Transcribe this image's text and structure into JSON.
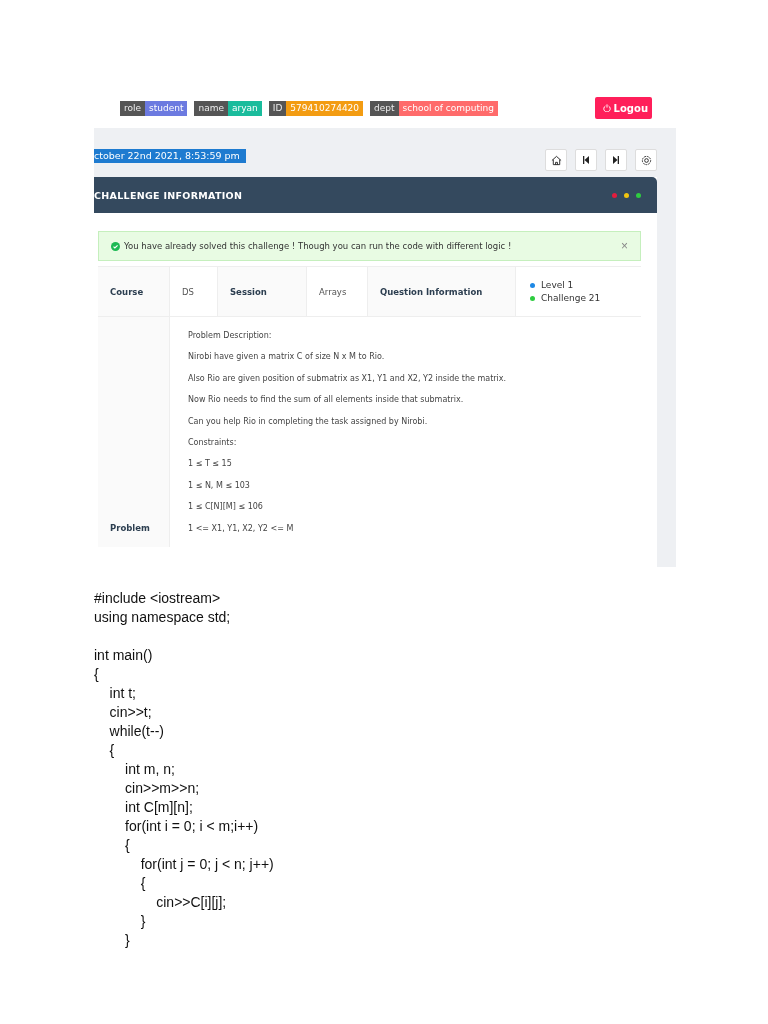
{
  "user_badges": [
    {
      "key": "role",
      "value": "student",
      "color": "#6c7ae0"
    },
    {
      "key": "name",
      "value": "aryan",
      "color": "#1abc9c"
    },
    {
      "key": "ID",
      "value": "579410274420",
      "color": "#f39c12"
    },
    {
      "key": "dept",
      "value": "school of computing",
      "color": "#ff6b6b"
    }
  ],
  "logout_button": "Logou",
  "date_badge": "ctober 22nd 2021, 8:53:59 pm",
  "card": {
    "title": "CHALLENGE INFORMATION",
    "alert": "You have already solved this challenge ! Though you can run the code with different logic !",
    "alert_close": "×",
    "info_row": [
      {
        "kind": "label",
        "text": "Course"
      },
      {
        "kind": "value",
        "text": "DS"
      },
      {
        "kind": "label",
        "text": "Session"
      },
      {
        "kind": "value",
        "text": "Arrays"
      },
      {
        "kind": "label",
        "text": "Question Information"
      }
    ],
    "question_info": [
      {
        "text": "Level 1",
        "color": "#1e88e5"
      },
      {
        "text": "Challenge 21",
        "color": "#2ecc40"
      }
    ],
    "problem_label": "Problem",
    "problem_lines": [
      "Problem Description:",
      "Nirobi have given a matrix C of size N x M to Rio.",
      "Also Rio are given position of submatrix as X1, Y1 and X2, Y2 inside the matrix.",
      "Now Rio needs to find the sum of all elements inside that submatrix.",
      "Can you help Rio in completing the task assigned by Nirobi.",
      "Constraints:",
      "1 ≤ T ≤ 15",
      "1 ≤ N, M ≤ 103",
      "1 ≤ C[N][M] ≤ 106",
      "1 <= X1, Y1, X2, Y2 <= M"
    ]
  },
  "code_blocks": [
    [
      "#include <iostream>",
      "using namespace std;"
    ],
    [
      "int main()",
      "{",
      "    int t;",
      "    cin>>t;",
      "    while(t--)",
      "    {",
      "        int m, n;",
      "        cin>>m>>n;",
      "        int C[m][n];",
      "        for(int i = 0; i < m;i++)",
      "        {",
      "            for(int j = 0; j < n; j++)",
      "            {",
      "                cin>>C[i][j];",
      "            }",
      "        }"
    ]
  ]
}
